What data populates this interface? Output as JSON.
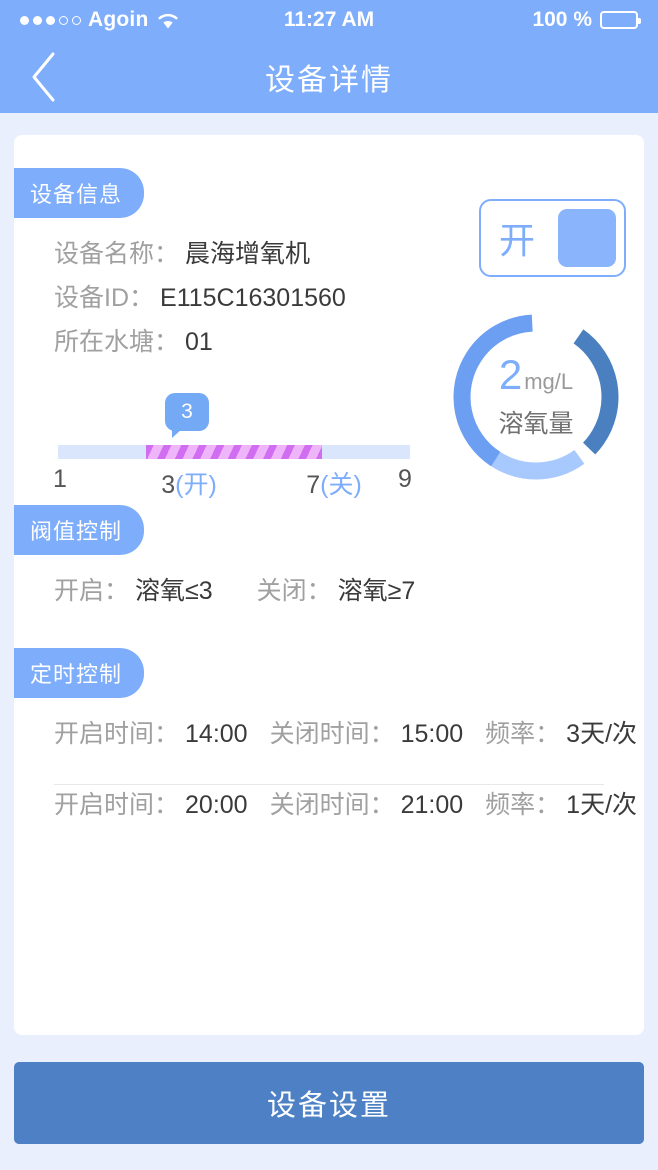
{
  "status_bar": {
    "carrier": "Agoin",
    "signal_dots_filled": 3,
    "signal_dots_total": 5,
    "wifi_icon": "wifi-icon",
    "time": "11:27 AM",
    "battery_percent": "100 %",
    "battery_icon": "battery-full-icon"
  },
  "nav": {
    "back_icon": "chevron-left-icon",
    "title": "设备详情"
  },
  "device_info": {
    "section_title": "设备信息",
    "fields": [
      {
        "label": "设备名称：",
        "value": "晨海增氧机"
      },
      {
        "label": "设备ID：",
        "value": "E115C16301560"
      },
      {
        "label": "所在水塘：",
        "value": "01"
      }
    ],
    "power_toggle": {
      "label": "开",
      "state": "on"
    },
    "gauge": {
      "value": "2",
      "unit": "mg/L",
      "name": "溶氧量",
      "segment_colors": [
        "#a8c9fd",
        "#6c9ef2",
        "#4a80c0"
      ]
    },
    "slider": {
      "tooltip_value": "3",
      "min": 1,
      "max": 9,
      "range_start": 3,
      "range_end": 7,
      "ticks": [
        {
          "num": "1",
          "suffix": ""
        },
        {
          "num": "3",
          "suffix": "(开)"
        },
        {
          "num": "7",
          "suffix": "(关)"
        },
        {
          "num": "9",
          "suffix": ""
        }
      ]
    }
  },
  "threshold_control": {
    "section_title": "阀值控制",
    "open_label": "开启：",
    "open_value": "溶氧≤3",
    "close_label": "关闭：",
    "close_value": "溶氧≥7"
  },
  "timer_control": {
    "section_title": "定时控制",
    "schedules": [
      {
        "on_label": "开启时间：",
        "on_value": "14:00",
        "off_label": "关闭时间：",
        "off_value": "15:00",
        "freq_label": "频率：",
        "freq_value": "3天/次"
      },
      {
        "on_label": "开启时间：",
        "on_value": "20:00",
        "off_label": "关闭时间：",
        "off_value": "21:00",
        "freq_label": "频率：",
        "freq_value": "1天/次"
      }
    ]
  },
  "footer": {
    "settings_button": "设备设置"
  },
  "theme": {
    "header_blue": "#7eadfb",
    "page_bg": "#e9effc",
    "button_blue": "#4d80c4",
    "track_bg": "#d9e6fb",
    "range_purple": "#d06df0"
  }
}
